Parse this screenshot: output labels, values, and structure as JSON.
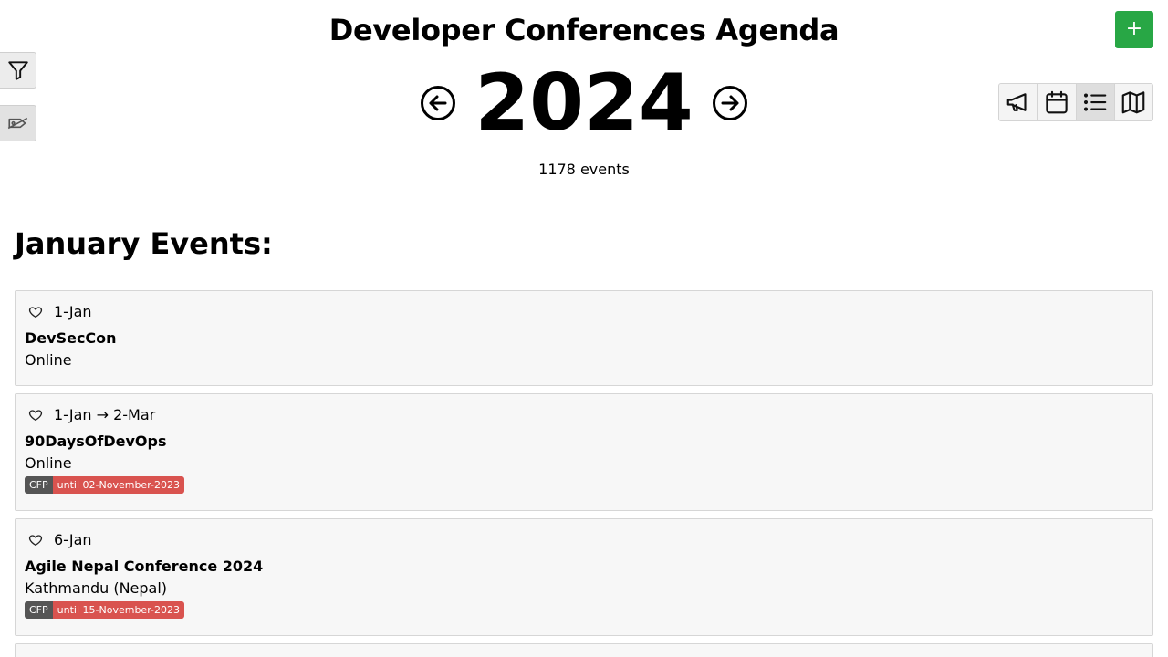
{
  "header": {
    "title": "Developer Conferences Agenda",
    "add_label": "+",
    "year": "2024",
    "event_count": "1178 events"
  },
  "month": {
    "heading": "January Events:"
  },
  "events": [
    {
      "date": "1-Jan",
      "name": "DevSecCon",
      "location": "Online",
      "cfp": null
    },
    {
      "date": "1-Jan → 2-Mar",
      "name": "90DaysOfDevOps",
      "location": "Online",
      "cfp": {
        "label": "CFP",
        "until": "until 02-November-2023"
      }
    },
    {
      "date": "6-Jan",
      "name": "Agile Nepal Conference 2024",
      "location": "Kathmandu (Nepal)",
      "cfp": {
        "label": "CFP",
        "until": "until 15-November-2023"
      }
    }
  ],
  "colors": {
    "accent_green": "#28a745",
    "cfp_dark": "#555555",
    "cfp_red": "#d9534f",
    "card_bg": "#f7f7f7"
  },
  "icons": {
    "filter": "filter-icon",
    "tag": "tag-icon",
    "prev": "arrow-left-circle-icon",
    "next": "arrow-right-circle-icon",
    "calls": "megaphone-icon",
    "calendar": "calendar-icon",
    "list": "list-icon",
    "map": "map-icon",
    "favorite": "heart-icon"
  }
}
